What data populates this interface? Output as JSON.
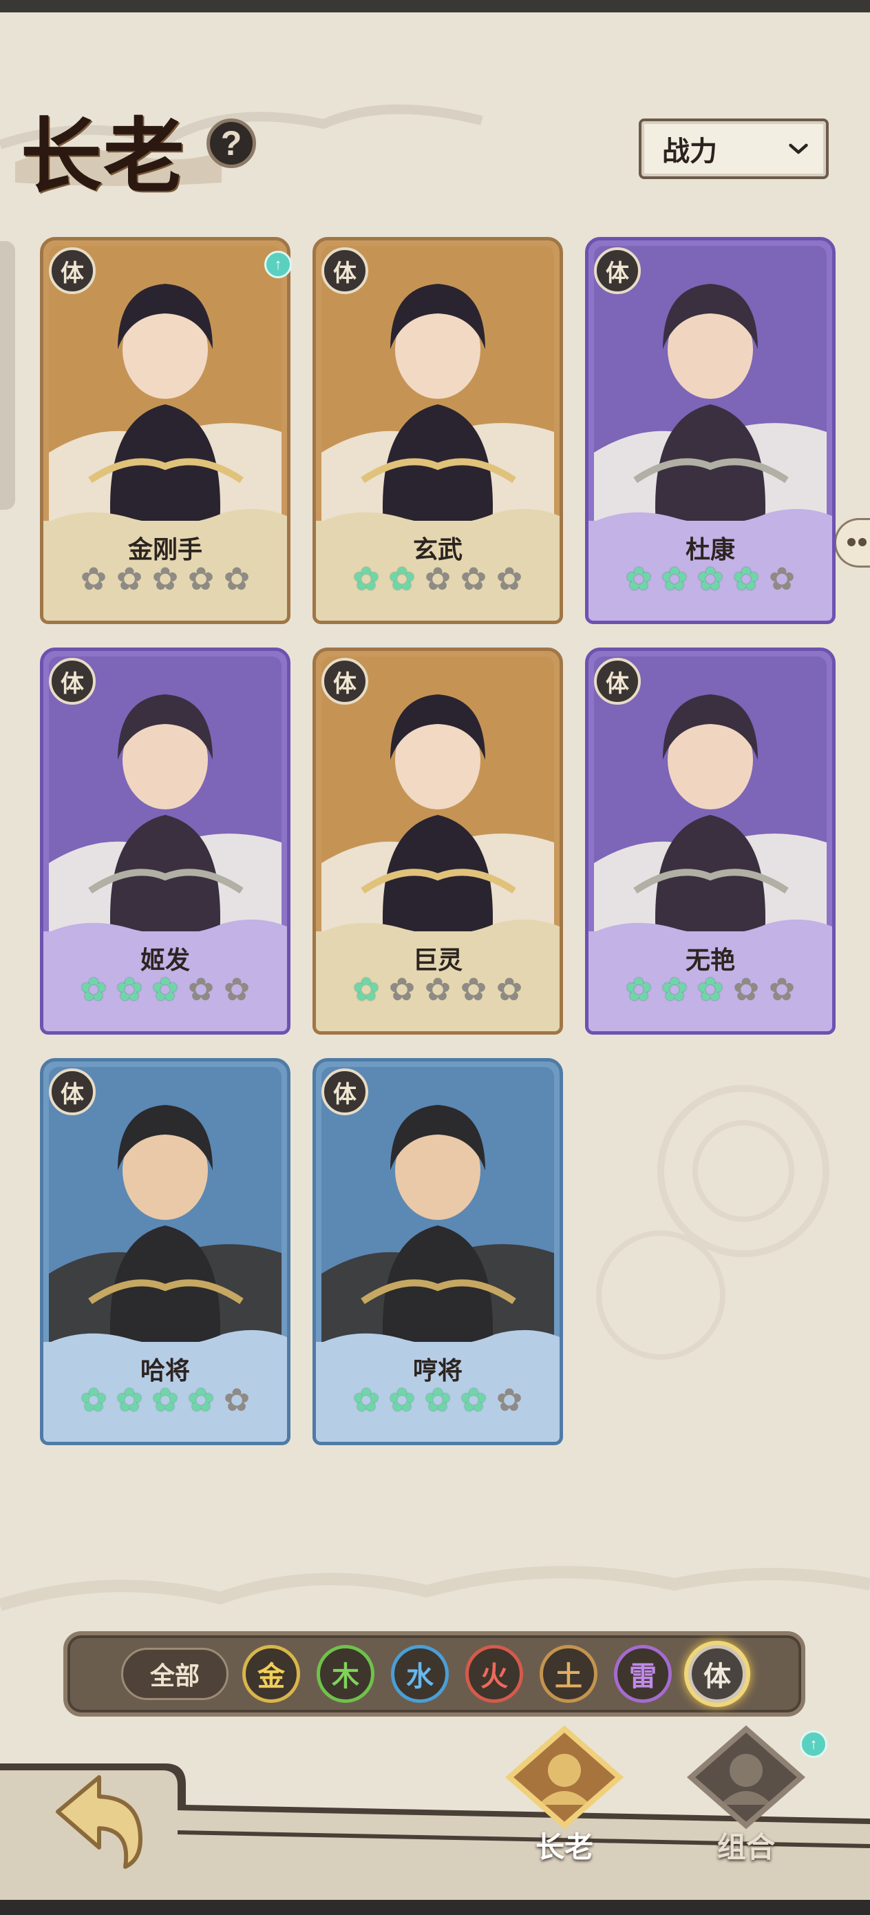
{
  "header": {
    "title": "长老",
    "help_glyph": "?",
    "sort_label": "战力"
  },
  "cards": [
    {
      "name": "金刚手",
      "element": "体",
      "rarity": "gold",
      "stars": 0,
      "upgrade": true
    },
    {
      "name": "玄武",
      "element": "体",
      "rarity": "gold",
      "stars": 2,
      "upgrade": false
    },
    {
      "name": "杜康",
      "element": "体",
      "rarity": "purple",
      "stars": 4,
      "upgrade": false
    },
    {
      "name": "姬发",
      "element": "体",
      "rarity": "purple",
      "stars": 3,
      "upgrade": false
    },
    {
      "name": "巨灵",
      "element": "体",
      "rarity": "gold",
      "stars": 1,
      "upgrade": false
    },
    {
      "name": "无艳",
      "element": "体",
      "rarity": "purple",
      "stars": 3,
      "upgrade": false
    },
    {
      "name": "哈将",
      "element": "体",
      "rarity": "blue",
      "stars": 4,
      "upgrade": false
    },
    {
      "name": "哼将",
      "element": "体",
      "rarity": "blue",
      "stars": 4,
      "upgrade": false
    }
  ],
  "max_stars": 5,
  "filters": {
    "all_label": "全部",
    "elements": [
      "金",
      "木",
      "水",
      "火",
      "土",
      "雷",
      "体"
    ],
    "selected": "体"
  },
  "nav": {
    "tabs": [
      {
        "label": "长老",
        "active": true
      },
      {
        "label": "组合",
        "active": false,
        "upgrade": true
      }
    ]
  },
  "colors": {
    "gold_card": "#c9985c",
    "purple_card": "#8d74c7",
    "blue_card": "#6f9ac2",
    "star_on": "#6fd6a8",
    "star_off": "#8e8a84"
  }
}
